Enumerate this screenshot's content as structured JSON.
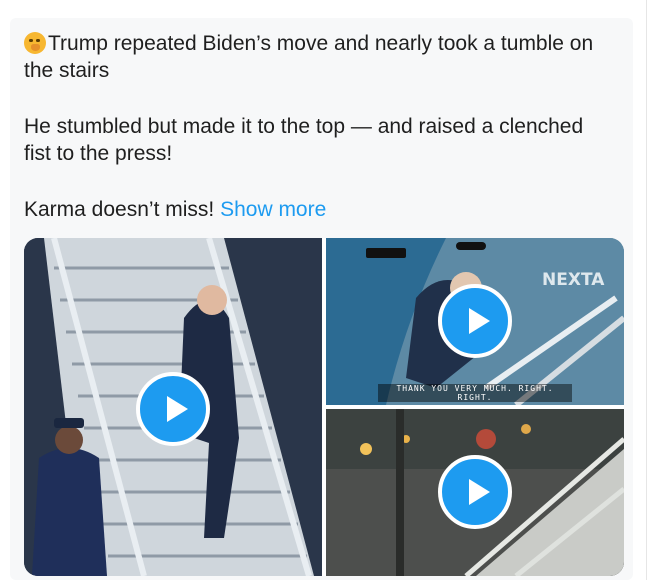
{
  "tweet": {
    "line1": "Trump repeated Biden’s move and nearly took a tumble on the stairs",
    "line2": "He stumbled but made it to the top — and raised a clenched fist to the press!",
    "line3_prefix": "Karma doesn’t miss! ",
    "show_more": "Show more",
    "emoji": "face-with-hand-over-mouth-icon"
  },
  "media": {
    "videos": [
      {
        "name": "video-left"
      },
      {
        "name": "video-top-right",
        "watermark": "NEXTA",
        "caption": "THANK YOU VERY MUCH. RIGHT. RIGHT."
      },
      {
        "name": "video-bottom-right"
      }
    ],
    "play_icon": "play-icon",
    "accent_color": "#1d9bf0"
  }
}
